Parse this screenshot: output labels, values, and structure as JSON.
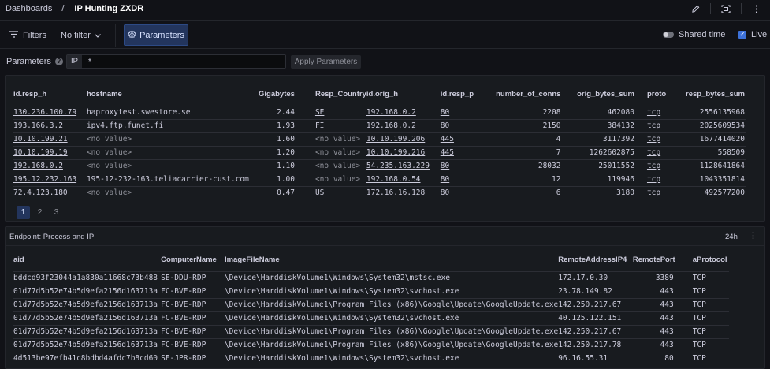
{
  "breadcrumb": {
    "root": "Dashboards",
    "separator": "/",
    "title": "IP Hunting ZXDR"
  },
  "toolbar": {
    "filters_label": "Filters",
    "filter_value": "No filter",
    "parameters_label": "Parameters",
    "shared_time_label": "Shared time",
    "live_label": "Live",
    "live_checked": true
  },
  "params": {
    "label": "Parameters",
    "tag": "IP",
    "value": "*",
    "apply_label": "Apply Parameters"
  },
  "table1": {
    "columns": [
      "id.resp_h",
      "hostname",
      "Gigabytes",
      "Resp_Country",
      "id.orig_h",
      "id.resp_p",
      "number_of_conns",
      "orig_bytes_sum",
      "proto",
      "resp_bytes_sum"
    ],
    "rows": [
      [
        "130.236.100.79",
        "haproxytest.swestore.se",
        "2.44",
        "SE",
        "192.168.0.2",
        "80",
        "2208",
        "462080",
        "tcp",
        "2556135968"
      ],
      [
        "193.166.3.2",
        "ipv4.ftp.funet.fi",
        "1.93",
        "FI",
        "192.168.0.2",
        "80",
        "2150",
        "384132",
        "tcp",
        "2025609534"
      ],
      [
        "10.10.199.21",
        "<no value>",
        "1.60",
        "<no value>",
        "10.10.199.206",
        "445",
        "4",
        "3117392",
        "tcp",
        "1677414020"
      ],
      [
        "10.10.199.19",
        "<no value>",
        "1.20",
        "<no value>",
        "10.10.199.216",
        "445",
        "7",
        "1262602875",
        "tcp",
        "558509"
      ],
      [
        "192.168.0.2",
        "<no value>",
        "1.10",
        "<no value>",
        "54.235.163.229",
        "80",
        "28032",
        "25011552",
        "tcp",
        "1128641864"
      ],
      [
        "195.12.232.163",
        "195-12-232-163.teliacarrier-cust.com",
        "1.00",
        "<no value>",
        "192.168.0.54",
        "80",
        "12",
        "119946",
        "tcp",
        "1043351814"
      ],
      [
        "72.4.123.180",
        "<no value>",
        "0.47",
        "US",
        "172.16.16.128",
        "80",
        "6",
        "3180",
        "tcp",
        "492577200"
      ]
    ],
    "pages": [
      "1",
      "2",
      "3"
    ],
    "active_page": "1"
  },
  "panel2": {
    "title": "Endpoint: Process and IP",
    "time_range": "24h",
    "menu_icon": "⋮",
    "columns": [
      "aid",
      "ComputerName",
      "ImageFileName",
      "RemoteAddressIP4",
      "RemotePort",
      "aProtocol"
    ],
    "rows": [
      [
        "bddcd93f23044a1a830a11668c73b488",
        "SE-DDU-RDP",
        "\\Device\\HarddiskVolume1\\Windows\\System32\\mstsc.exe",
        "172.17.0.30",
        "3389",
        "TCP"
      ],
      [
        "01d77d5b52e74b5d9efa2156d163713a",
        "FC-BVE-RDP",
        "\\Device\\HarddiskVolume1\\Windows\\System32\\svchost.exe",
        "23.78.149.82",
        "443",
        "TCP"
      ],
      [
        "01d77d5b52e74b5d9efa2156d163713a",
        "FC-BVE-RDP",
        "\\Device\\HarddiskVolume1\\Program Files (x86)\\Google\\Update\\GoogleUpdate.exe",
        "142.250.217.67",
        "443",
        "TCP"
      ],
      [
        "01d77d5b52e74b5d9efa2156d163713a",
        "FC-BVE-RDP",
        "\\Device\\HarddiskVolume1\\Windows\\System32\\svchost.exe",
        "40.125.122.151",
        "443",
        "TCP"
      ],
      [
        "01d77d5b52e74b5d9efa2156d163713a",
        "FC-BVE-RDP",
        "\\Device\\HarddiskVolume1\\Program Files (x86)\\Google\\Update\\GoogleUpdate.exe",
        "142.250.217.67",
        "443",
        "TCP"
      ],
      [
        "01d77d5b52e74b5d9efa2156d163713a",
        "FC-BVE-RDP",
        "\\Device\\HarddiskVolume1\\Program Files (x86)\\Google\\Update\\GoogleUpdate.exe",
        "142.250.217.78",
        "443",
        "TCP"
      ],
      [
        "4d513be97efb41c8bdbd4afdc7b8cd60",
        "SE-JPR-RDP",
        "\\Device\\HarddiskVolume1\\Windows\\System32\\svchost.exe",
        "96.16.55.31",
        "80",
        "TCP"
      ]
    ]
  },
  "icons": {
    "edit": "pencil-icon",
    "expand": "fullscreen-icon",
    "more": "more-vertical-icon",
    "filter": "filter-icon",
    "chevron": "chevron-down-icon",
    "gear": "gear-icon",
    "help": "help-icon"
  },
  "colors": {
    "accent": "#3d71d9",
    "active_bg": "#23355d",
    "background": "#111217",
    "panel": "#181b1f"
  }
}
